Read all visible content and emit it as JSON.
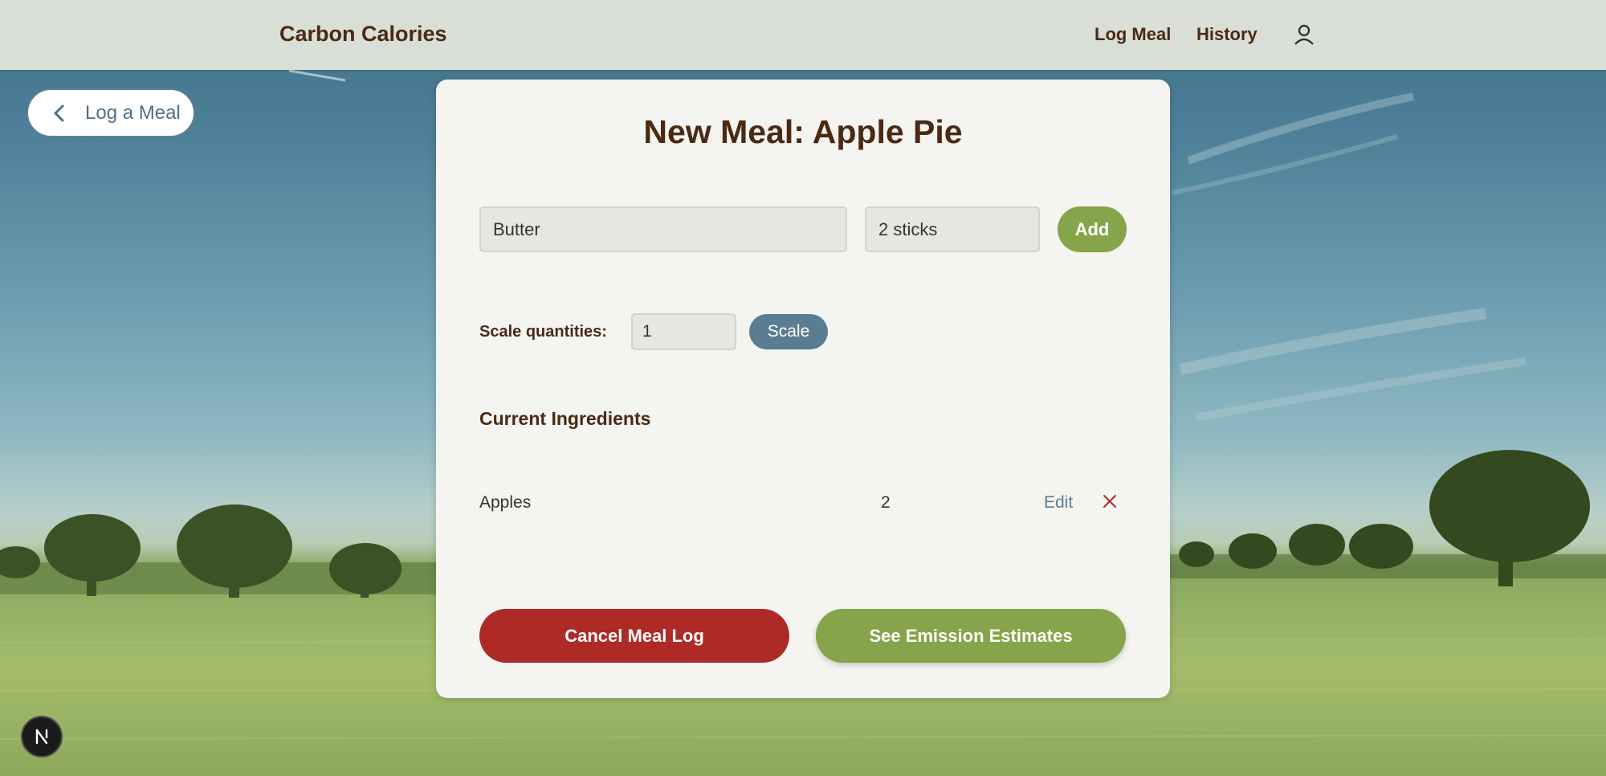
{
  "app": {
    "brand": "Carbon Calories",
    "nav": {
      "log_meal": "Log Meal",
      "history": "History"
    }
  },
  "back": {
    "label": "Log a Meal"
  },
  "form": {
    "title": "New Meal: Apple Pie",
    "ingredient_value": "Butter",
    "quantity_value": "2 sticks",
    "add_label": "Add",
    "scale_label": "Scale quantities:",
    "scale_value": "1",
    "scale_button": "Scale"
  },
  "ingredients": {
    "title": "Current Ingredients",
    "items": [
      {
        "name": "Apples",
        "quantity": "2",
        "edit_label": "Edit"
      }
    ]
  },
  "actions": {
    "cancel": "Cancel Meal Log",
    "estimate": "See Emission Estimates"
  },
  "colors": {
    "brand_text": "#4a2a14",
    "accent_green": "#86a449",
    "accent_blue": "#5b7d91",
    "danger_red": "#ad2a26"
  },
  "icons": {
    "user": "user-icon",
    "back": "chevron-left-icon",
    "delete": "close-icon",
    "badge": "nextjs-logo-icon"
  }
}
